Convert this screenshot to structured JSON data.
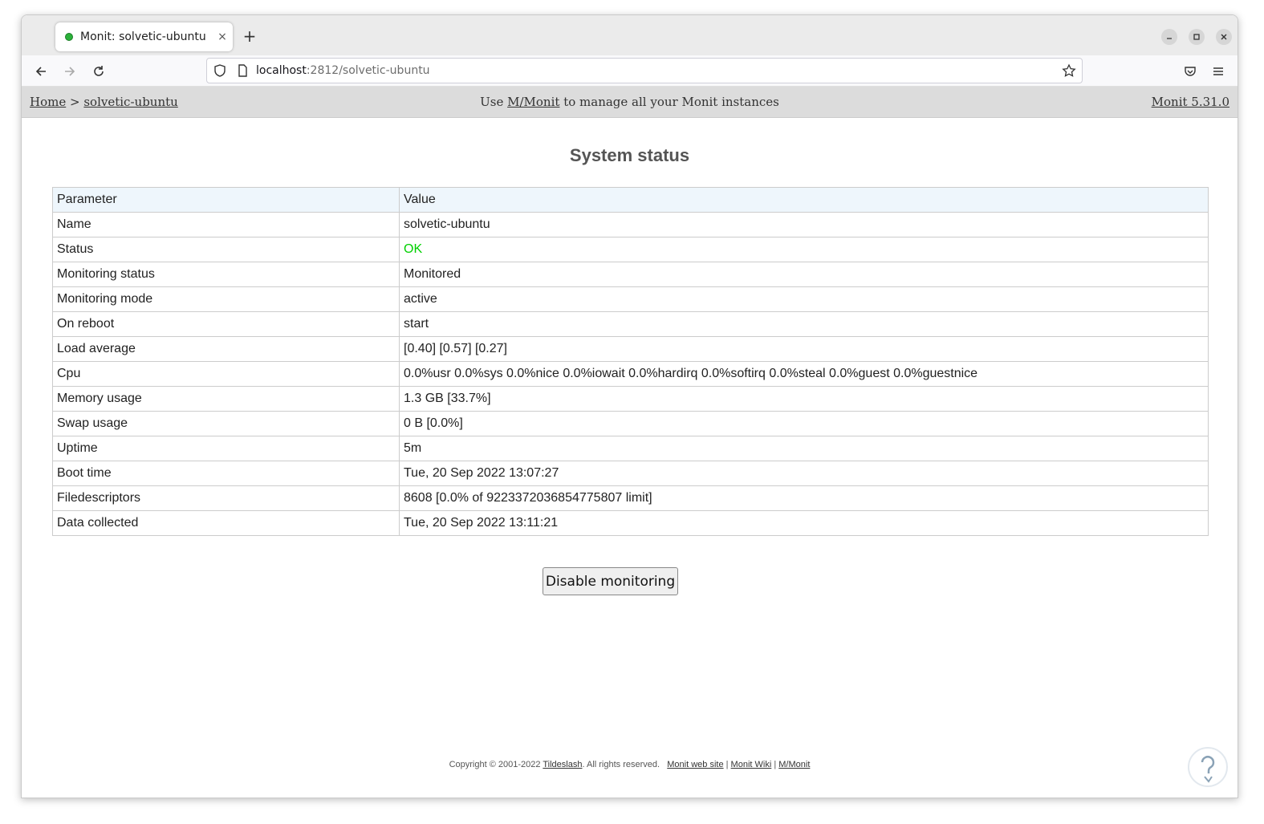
{
  "browser": {
    "tab_title": "Monit: solvetic-ubuntu",
    "tab_close": "×",
    "new_tab": "+",
    "url_host": "localhost",
    "url_rest": ":2812/solvetic-ubuntu"
  },
  "header": {
    "home_link": "Home",
    "separator": ">",
    "host_link": "solvetic-ubuntu",
    "msg_prefix": "Use",
    "msg_link": "M/Monit",
    "msg_suffix": "to manage all your Monit instances",
    "version": "Monit 5.31.0"
  },
  "main": {
    "title": "System status",
    "table": {
      "headers": [
        "Parameter",
        "Value"
      ],
      "rows": [
        {
          "param": "Name",
          "value": "solvetic-ubuntu"
        },
        {
          "param": "Status",
          "value": "OK"
        },
        {
          "param": "Monitoring status",
          "value": "Monitored"
        },
        {
          "param": "Monitoring mode",
          "value": "active"
        },
        {
          "param": "On reboot",
          "value": "start"
        },
        {
          "param": "Load average",
          "value": "[0.40] [0.57] [0.27]"
        },
        {
          "param": "Cpu",
          "value": "0.0%usr 0.0%sys 0.0%nice 0.0%iowait 0.0%hardirq 0.0%softirq 0.0%steal 0.0%guest 0.0%guestnice"
        },
        {
          "param": "Memory usage",
          "value": "1.3 GB [33.7%]"
        },
        {
          "param": "Swap usage",
          "value": "0 B [0.0%]"
        },
        {
          "param": "Uptime",
          "value": "5m"
        },
        {
          "param": "Boot time",
          "value": "Tue, 20 Sep 2022 13:07:27"
        },
        {
          "param": "Filedescriptors",
          "value": "8608 [0.0% of 9223372036854775807 limit]"
        },
        {
          "param": "Data collected",
          "value": "Tue, 20 Sep 2022 13:11:21"
        }
      ]
    },
    "button_label": "Disable monitoring"
  },
  "footer": {
    "copyright": "Copyright © 2001-2022",
    "company_link": "Tildeslash",
    "rights": ". All rights reserved.",
    "link_website": "Monit web site",
    "link_wiki": "Monit Wiki",
    "link_mmonit": "M/Monit",
    "sep": "|"
  },
  "colors": {
    "status_ok": "#00d000",
    "header_bg": "#dcdcdc",
    "table_header_bg": "#eef6fc"
  },
  "icons": [
    "back-arrow-icon",
    "forward-arrow-icon",
    "reload-icon",
    "shield-icon",
    "page-icon",
    "star-icon",
    "pocket-icon",
    "menu-icon",
    "minimize-icon",
    "maximize-icon",
    "close-icon"
  ]
}
